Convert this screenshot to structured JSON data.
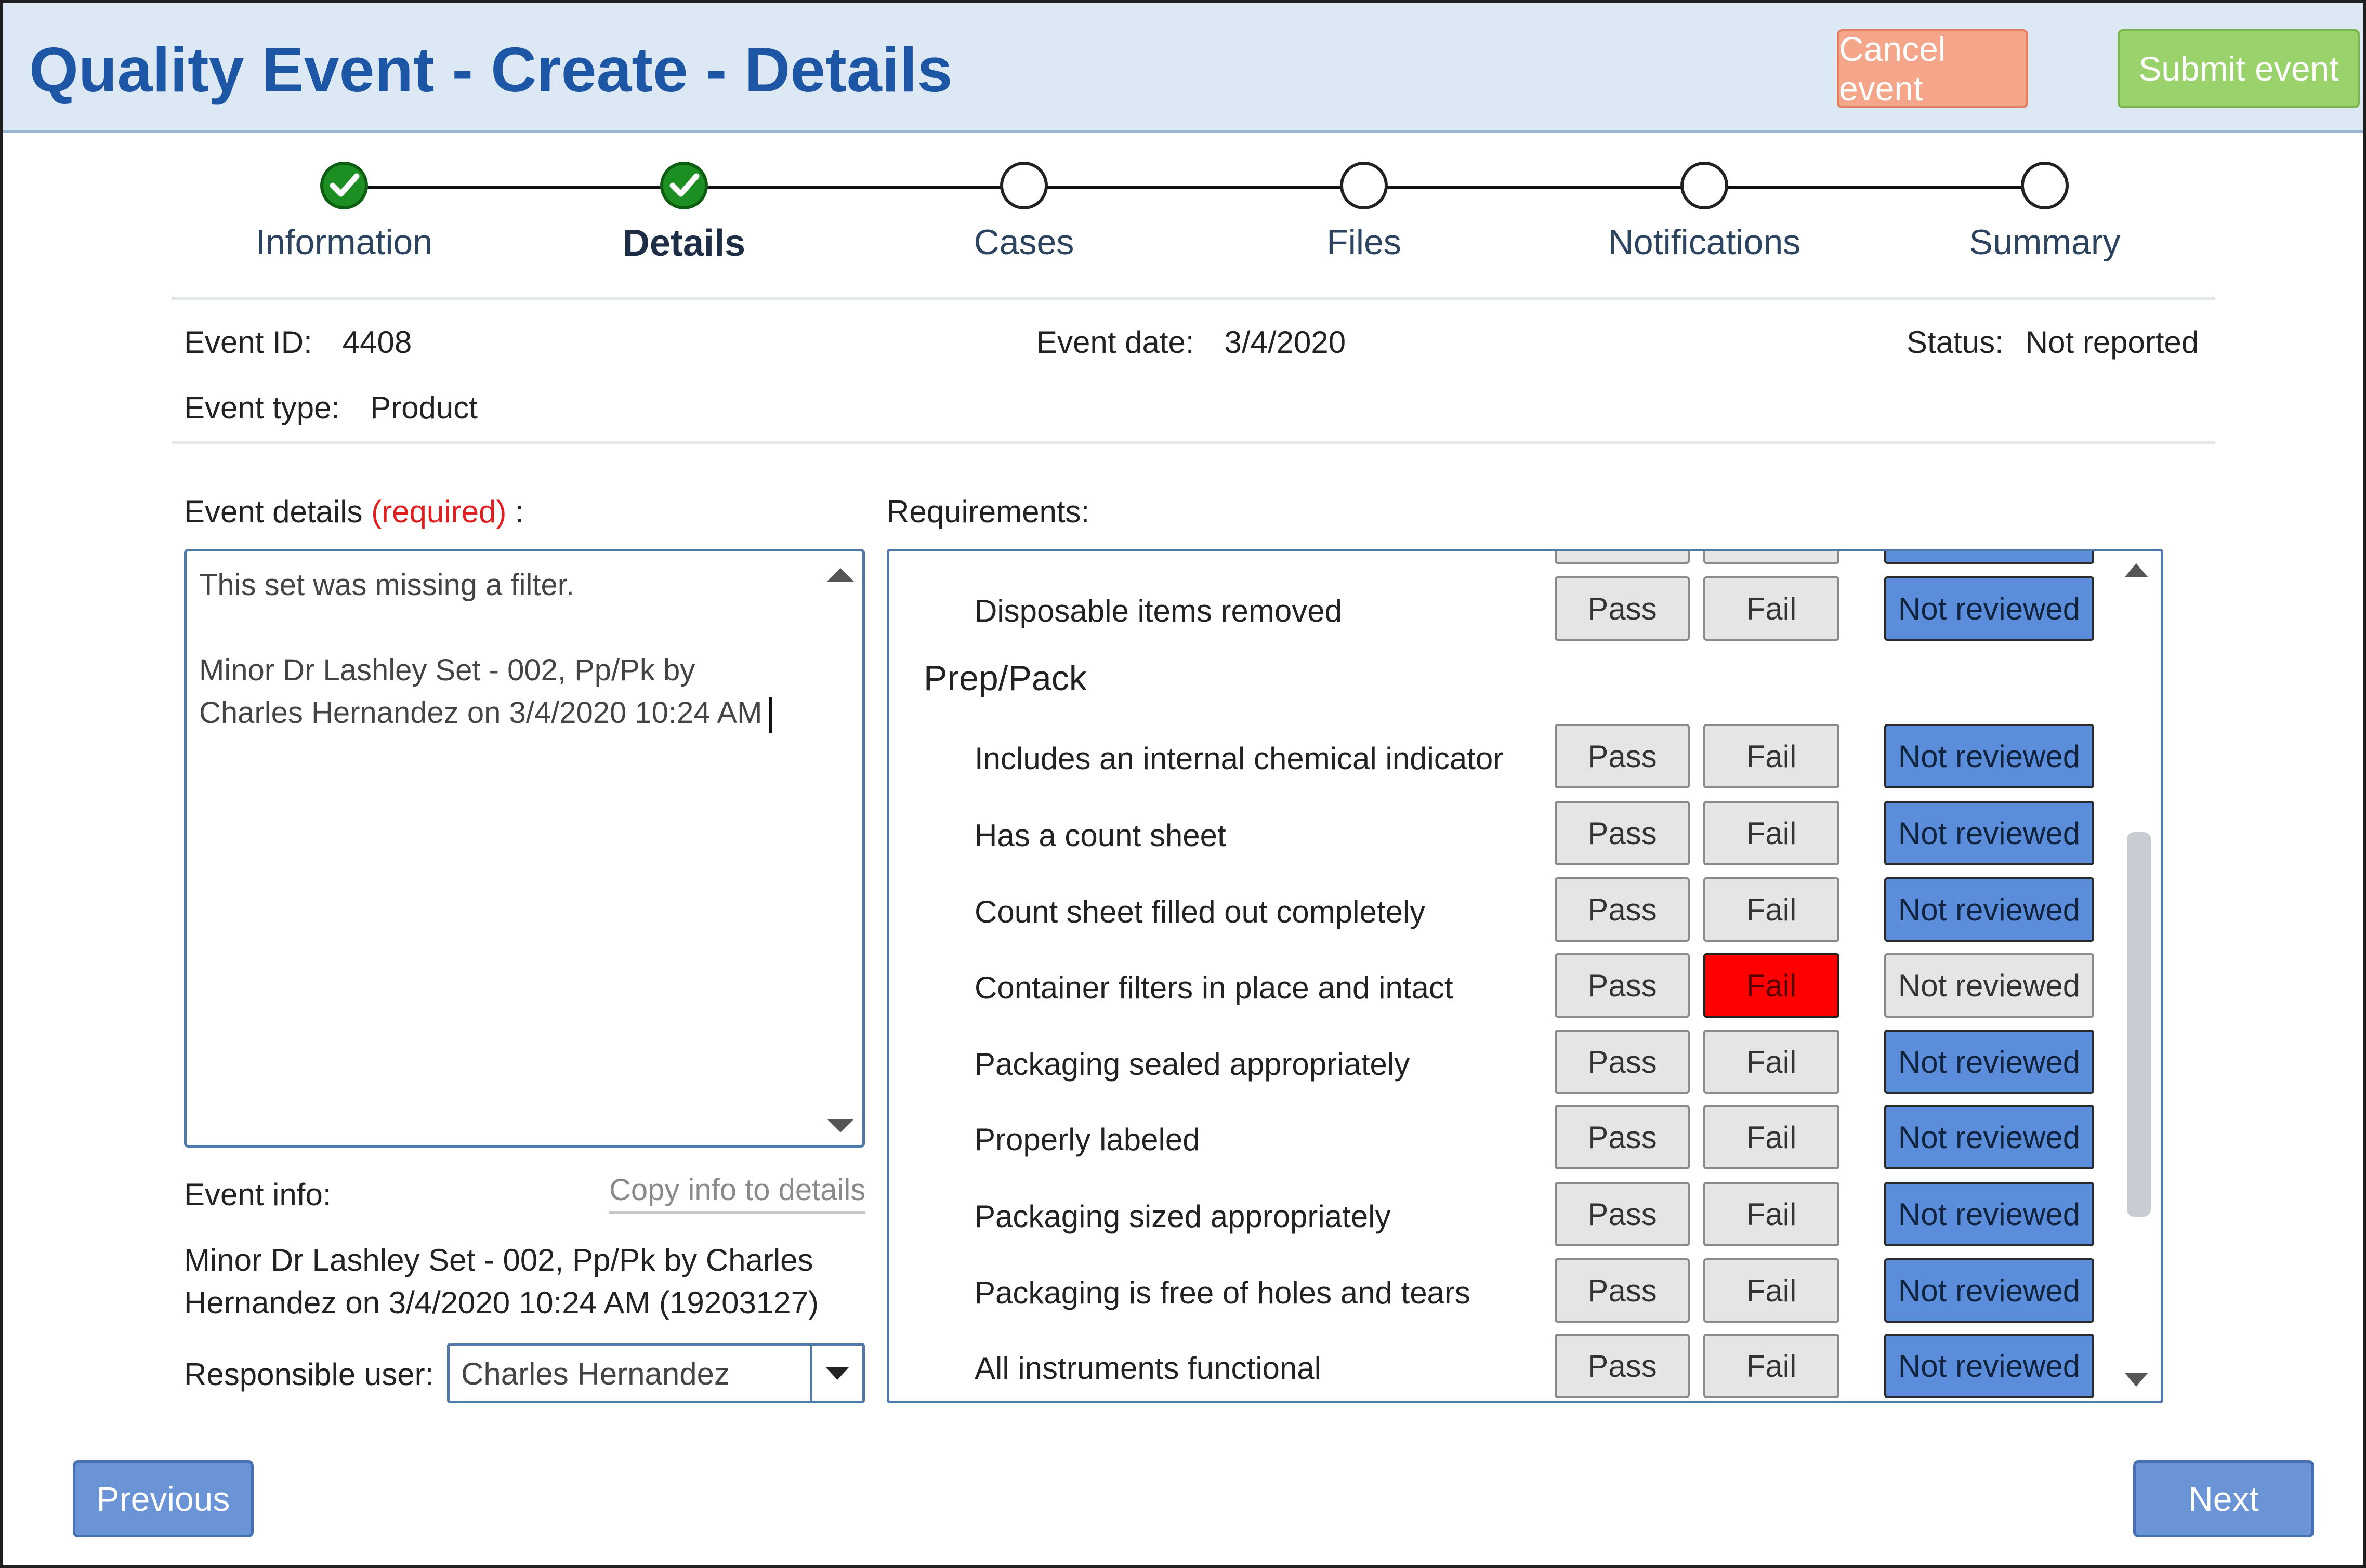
{
  "header": {
    "title": "Quality Event - Create - Details",
    "cancel_label": "Cancel event",
    "submit_label": "Submit event",
    "colors": {
      "title": "#1d56a4",
      "cancel": "#f5a58a",
      "submit": "#9ad36b"
    }
  },
  "stepper": {
    "steps": [
      {
        "label": "Information",
        "state": "done"
      },
      {
        "label": "Details",
        "state": "done-active"
      },
      {
        "label": "Cases",
        "state": "pending"
      },
      {
        "label": "Files",
        "state": "pending"
      },
      {
        "label": "Notifications",
        "state": "pending"
      },
      {
        "label": "Summary",
        "state": "pending"
      }
    ],
    "check_icon": "check-icon"
  },
  "meta": {
    "event_id_label": "Event ID:",
    "event_id": "4408",
    "event_date_label": "Event date:",
    "event_date": "3/4/2020",
    "status_label": "Status:",
    "status": "Not reported",
    "event_type_label": "Event type:",
    "event_type": "Product"
  },
  "details": {
    "label": "Event details",
    "required": "(required)",
    "suffix": " :",
    "line1": "This set was missing a filter.",
    "line2": "Minor Dr Lashley Set - 002, Pp/Pk by",
    "line3": "Charles Hernandez on 3/4/2020 10:24 AM"
  },
  "event_info": {
    "label": "Event info:",
    "copy_link": "Copy info to details",
    "line1": "Minor Dr Lashley Set - 002, Pp/Pk by Charles",
    "line2": "Hernandez on 3/4/2020 10:24 AM (19203127)"
  },
  "responsible": {
    "label": "Responsible user:",
    "value": "Charles Hernandez"
  },
  "requirements": {
    "label": "Requirements:",
    "pass_label": "Pass",
    "fail_label": "Fail",
    "not_reviewed_label": "Not reviewed",
    "group_title": "Prep/Pack",
    "top_item": {
      "label": "Disposable items removed",
      "selected": "not_reviewed"
    },
    "items": [
      {
        "label": "Includes an internal chemical indicator",
        "selected": "not_reviewed"
      },
      {
        "label": "Has a count sheet",
        "selected": "not_reviewed"
      },
      {
        "label": "Count sheet filled out completely",
        "selected": "not_reviewed"
      },
      {
        "label": "Container filters in place and intact",
        "selected": "fail"
      },
      {
        "label": "Packaging sealed appropriately",
        "selected": "not_reviewed"
      },
      {
        "label": "Properly labeled",
        "selected": "not_reviewed"
      },
      {
        "label": "Packaging sized appropriately",
        "selected": "not_reviewed"
      },
      {
        "label": "Packaging is free of holes and tears",
        "selected": "not_reviewed"
      },
      {
        "label": "All instruments functional",
        "selected": "not_reviewed"
      }
    ],
    "colors": {
      "not_reviewed_selected": "#5b8ddb",
      "fail_selected": "#ff0000"
    }
  },
  "footer": {
    "previous_label": "Previous",
    "next_label": "Next"
  }
}
